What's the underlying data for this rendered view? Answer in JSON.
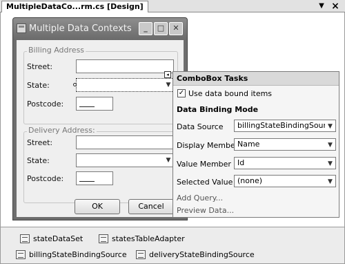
{
  "document_tab": {
    "title": "MultipleDataCo...rm.cs [Design]",
    "menu_icon": "chevron-down-icon",
    "close_icon": "close-icon"
  },
  "form": {
    "title": "Multiple Data Contexts",
    "caption_buttons": {
      "minimize": "minimize-icon",
      "maximize": "maximize-icon",
      "close": "close-icon"
    },
    "billing_group": {
      "legend": "Billing Address",
      "street_label": "Street:",
      "state_label": "State:",
      "postcode_label": "Postcode:"
    },
    "delivery_group": {
      "legend": "Delivery Address:",
      "street_label": "Street:",
      "state_label": "State:",
      "postcode_label": "Postcode:"
    },
    "ok_label": "OK",
    "cancel_label": "Cancel"
  },
  "tasks": {
    "title": "ComboBox Tasks",
    "use_data_bound": {
      "label": "Use data bound items",
      "checked": true
    },
    "section_title": "Data Binding Mode",
    "rows": [
      {
        "label": "Data Source",
        "value": "billingStateBindingSource"
      },
      {
        "label": "Display Member",
        "value": "Name"
      },
      {
        "label": "Value Member",
        "value": "Id"
      },
      {
        "label": "Selected Value",
        "value": "(none)"
      }
    ],
    "add_query": "Add Query...",
    "preview_data": "Preview Data..."
  },
  "tray": {
    "items": [
      {
        "label": "stateDataSet",
        "icon": "dataset-icon"
      },
      {
        "label": "statesTableAdapter",
        "icon": "table-adapter-icon"
      },
      {
        "label": "billingStateBindingSource",
        "icon": "binding-source-icon"
      },
      {
        "label": "deliveryStateBindingSource",
        "icon": "binding-source-icon"
      }
    ]
  },
  "colors": {
    "title_bar": "#7a7a7a",
    "form_client": "#efefef",
    "tasks_header": "#d9d9d9",
    "tray": "#ececec"
  }
}
